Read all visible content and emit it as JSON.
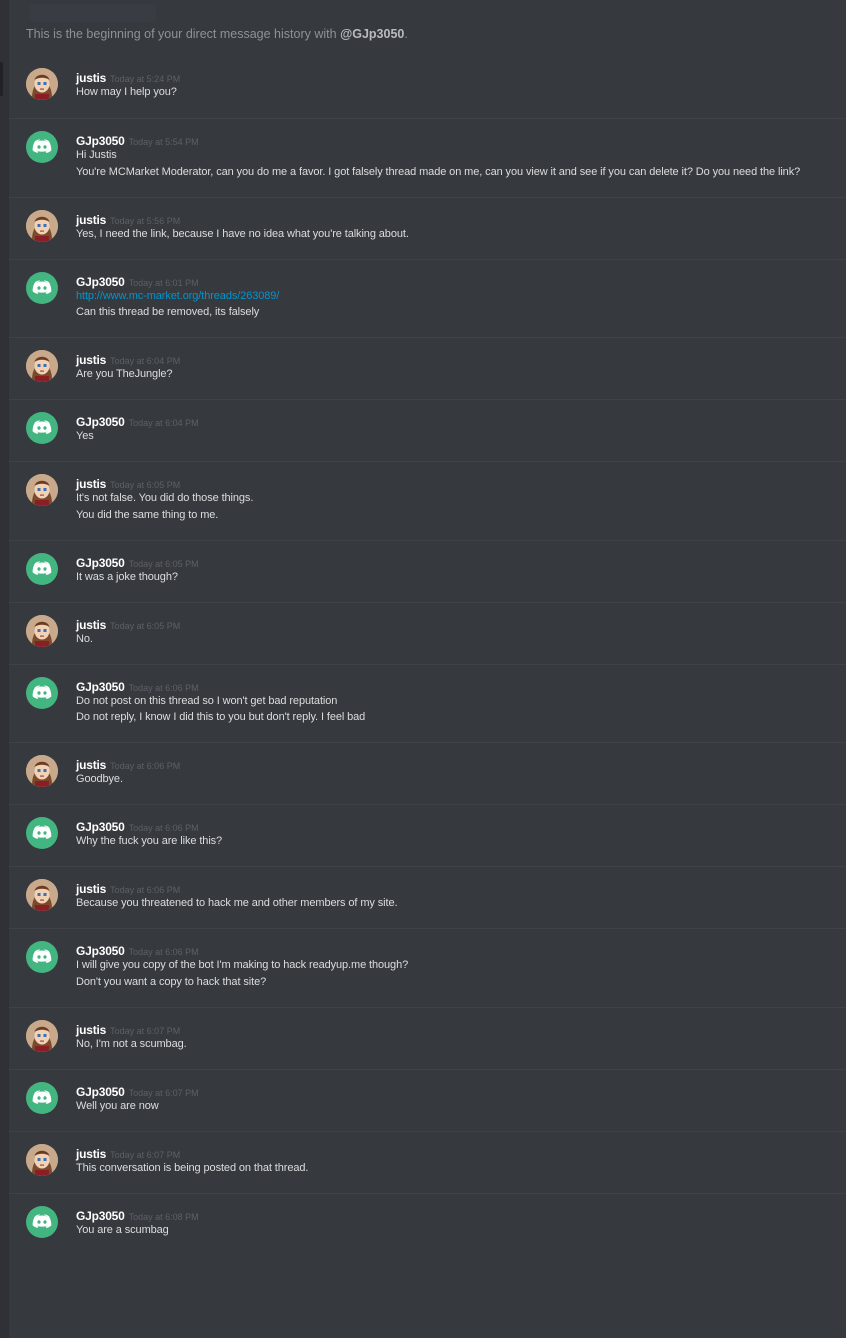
{
  "header": {
    "intro_prefix": "This is the beginning of your direct message history with",
    "intro_user": "@GJp3050",
    "intro_suffix": "."
  },
  "colors": {
    "background": "#36393e",
    "link": "#0096cf",
    "discord_avatar": "#43b581"
  },
  "messages": [
    {
      "user": "justis",
      "avatar": "justis-avatar",
      "time": "Today at 5:24 PM",
      "lines": [
        "How may I help you?"
      ]
    },
    {
      "user": "GJp3050",
      "avatar": "discord-default-avatar",
      "time": "Today at 5:54 PM",
      "lines": [
        "Hi Justis",
        "You're MCMarket Moderator, can you do me a favor. I got falsely thread made on me, can you view it and see if you can delete it? Do you need the link?"
      ]
    },
    {
      "user": "justis",
      "avatar": "justis-avatar",
      "time": "Today at 5:56 PM",
      "lines": [
        "Yes, I need the link, because I have no idea what you're talking about."
      ]
    },
    {
      "user": "GJp3050",
      "avatar": "discord-default-avatar",
      "time": "Today at 6:01 PM",
      "link": "http://www.mc-market.org/threads/263089/",
      "lines": [
        "Can this thread be removed, its falsely"
      ]
    },
    {
      "user": "justis",
      "avatar": "justis-avatar",
      "time": "Today at 6:04 PM",
      "lines": [
        "Are you TheJungle?"
      ]
    },
    {
      "user": "GJp3050",
      "avatar": "discord-default-avatar",
      "time": "Today at 6:04 PM",
      "lines": [
        "Yes"
      ]
    },
    {
      "user": "justis",
      "avatar": "justis-avatar",
      "time": "Today at 6:05 PM",
      "lines": [
        "It's not false. You did do those things.",
        "You did the same thing to me."
      ]
    },
    {
      "user": "GJp3050",
      "avatar": "discord-default-avatar",
      "time": "Today at 6:05 PM",
      "lines": [
        "It was a joke though?"
      ]
    },
    {
      "user": "justis",
      "avatar": "justis-avatar",
      "time": "Today at 6:05 PM",
      "lines": [
        "No."
      ]
    },
    {
      "user": "GJp3050",
      "avatar": "discord-default-avatar",
      "time": "Today at 6:06 PM",
      "lines": [
        "Do not post on this thread so I won't get bad reputation",
        "Do not reply, I know I did this to you but don't reply. I feel bad"
      ]
    },
    {
      "user": "justis",
      "avatar": "justis-avatar",
      "time": "Today at 6:06 PM",
      "lines": [
        "Goodbye."
      ]
    },
    {
      "user": "GJp3050",
      "avatar": "discord-default-avatar",
      "time": "Today at 6:06 PM",
      "lines": [
        "Why the fuck you are like this?"
      ]
    },
    {
      "user": "justis",
      "avatar": "justis-avatar",
      "time": "Today at 6:06 PM",
      "lines": [
        "Because you threatened to hack me and other members of my site."
      ]
    },
    {
      "user": "GJp3050",
      "avatar": "discord-default-avatar",
      "time": "Today at 6:06 PM",
      "lines": [
        "I will give you copy of the bot I'm making to hack readyup.me though?",
        "Don't you want a copy to hack that site?"
      ]
    },
    {
      "user": "justis",
      "avatar": "justis-avatar",
      "time": "Today at 6:07 PM",
      "lines": [
        "No, I'm not a scumbag."
      ]
    },
    {
      "user": "GJp3050",
      "avatar": "discord-default-avatar",
      "time": "Today at 6:07 PM",
      "lines": [
        "Well you are now"
      ]
    },
    {
      "user": "justis",
      "avatar": "justis-avatar",
      "time": "Today at 6:07 PM",
      "lines": [
        "This conversation is being posted on that thread."
      ]
    },
    {
      "user": "GJp3050",
      "avatar": "discord-default-avatar",
      "time": "Today at 6:08 PM",
      "lines": [
        "You are a scumbag"
      ]
    }
  ]
}
